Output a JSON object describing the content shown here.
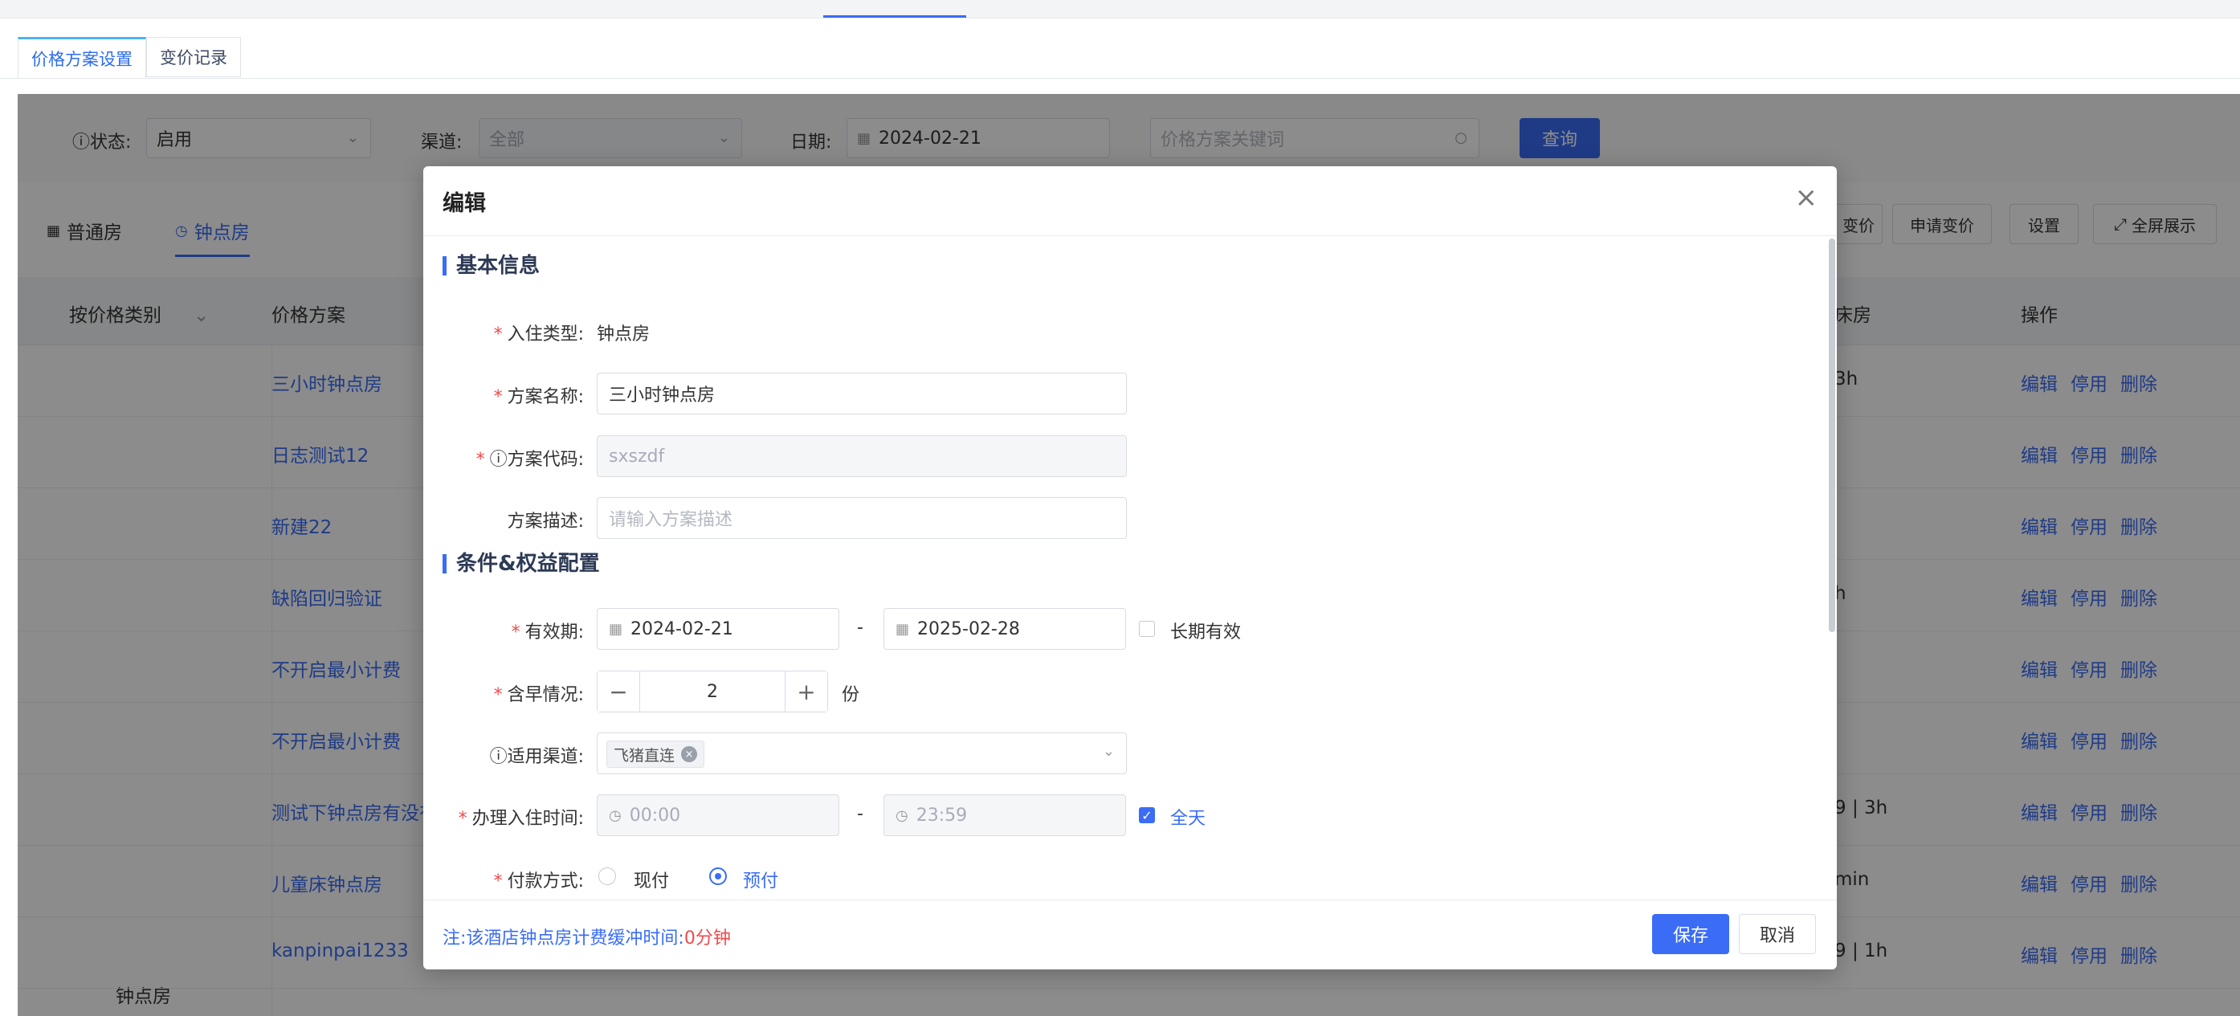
{
  "tabs": [
    "价格方案设置",
    "变价记录"
  ],
  "filters": {
    "status_label": "状态:",
    "status_value": "启用",
    "channel_label": "渠道:",
    "channel_value": "全部",
    "date_label": "日期:",
    "date_value": "2024-02-21",
    "keyword_placeholder": "价格方案关键词",
    "query_label": "查询"
  },
  "sub_tabs": [
    "普通房",
    "钟点房"
  ],
  "toolbar": {
    "partial_label": "变价",
    "apply_label": "申请变价",
    "settings_label": "设置",
    "fullscreen_label": "全屏展示"
  },
  "table": {
    "headers": {
      "category": "按价格类别",
      "plan": "价格方案",
      "partial": "床房",
      "ops": "操作"
    },
    "category_value": "钟点房",
    "rows": [
      {
        "name": "三小时钟点房",
        "cell": "3h"
      },
      {
        "name": "日志测试12",
        "cell": ""
      },
      {
        "name": "新建22",
        "cell": ""
      },
      {
        "name": "缺陷回归验证",
        "cell": "h"
      },
      {
        "name": "不开启最小计费",
        "cell": ""
      },
      {
        "name": "不开启最小计费",
        "cell": ""
      },
      {
        "name": "测试下钟点房有没有",
        "cell": "9 | 3h"
      },
      {
        "name": "儿童床钟点房",
        "cell": "min"
      },
      {
        "name": "kanpinpai1233",
        "cell": "9 | 1h"
      }
    ],
    "actions": {
      "edit": "编辑",
      "disable": "停用",
      "delete": "删除"
    }
  },
  "modal": {
    "title": "编辑",
    "section_basic": "基本信息",
    "checkin_type_label": "入住类型:",
    "checkin_type_value": "钟点房",
    "plan_name_label": "方案名称:",
    "plan_name_value": "三小时钟点房",
    "plan_code_label": "方案代码:",
    "plan_code_value": "sxszdf",
    "plan_desc_label": "方案描述:",
    "plan_desc_placeholder": "请输入方案描述",
    "section_conditions": "条件&权益配置",
    "valid_label": "有效期:",
    "valid_start": "2024-02-21",
    "valid_end": "2025-02-28",
    "dash": "-",
    "long_term_label": "长期有效",
    "breakfast_label": "含早情况:",
    "breakfast_value": "2",
    "breakfast_unit": "份",
    "channel_label": "适用渠道:",
    "channel_tag": "飞猪直连",
    "checkin_time_label": "办理入住时间:",
    "checkin_start": "00:00",
    "checkin_end": "23:59",
    "all_day_label": "全天",
    "payment_label": "付款方式:",
    "pay_now_label": "现付",
    "prepay_label": "预付",
    "note_prefix": "注:该酒店钟点房计费缓冲时间:",
    "note_value": "0分钟",
    "save_label": "保存",
    "cancel_label": "取消"
  }
}
